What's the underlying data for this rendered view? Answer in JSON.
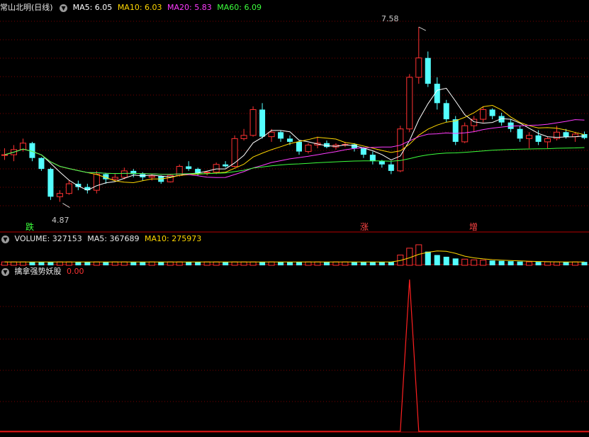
{
  "price_panel": {
    "title": "常山北明(日线)",
    "ma_legend": [
      {
        "label": "MA5: 6.05",
        "color": "#ffffff"
      },
      {
        "label": "MA10: 6.03",
        "color": "#ffd700"
      },
      {
        "label": "MA20: 5.83",
        "color": "#ff3cff"
      },
      {
        "label": "MA60: 6.09",
        "color": "#3cff3c"
      }
    ],
    "high_label": "7.58",
    "low_label": "4.87",
    "signals": [
      {
        "text": "跌",
        "color": "#3cff3c"
      },
      {
        "text": "涨",
        "color": "#ff4444"
      },
      {
        "text": "增",
        "color": "#ff4444"
      }
    ]
  },
  "volume_panel": {
    "title": "VOLUME: 327153",
    "ma5": "MA5: 367689",
    "ma10": "MA10: 275973"
  },
  "indicator_panel": {
    "title": "擒拿强势妖股",
    "value": "0.00"
  },
  "colors": {
    "up": "#ff3232",
    "down": "#54ffff",
    "grid": "#7a0000",
    "divider": "#b40000"
  },
  "chart_data": {
    "type": "candlestick",
    "approx_ohlc": [
      [
        5.6,
        5.7,
        5.52,
        5.6
      ],
      [
        5.6,
        5.75,
        5.5,
        5.68
      ],
      [
        5.68,
        5.85,
        5.65,
        5.78
      ],
      [
        5.78,
        5.8,
        5.5,
        5.55
      ],
      [
        5.55,
        5.56,
        5.35,
        5.38
      ],
      [
        5.38,
        5.4,
        4.9,
        4.95
      ],
      [
        4.95,
        5.05,
        4.87,
        5.0
      ],
      [
        5.0,
        5.2,
        4.98,
        5.15
      ],
      [
        5.15,
        5.2,
        5.05,
        5.1
      ],
      [
        5.1,
        5.15,
        5.0,
        5.05
      ],
      [
        5.05,
        5.35,
        5.0,
        5.3
      ],
      [
        5.3,
        5.32,
        5.15,
        5.22
      ],
      [
        5.22,
        5.3,
        5.18,
        5.25
      ],
      [
        5.25,
        5.4,
        5.22,
        5.35
      ],
      [
        5.35,
        5.38,
        5.25,
        5.3
      ],
      [
        5.3,
        5.33,
        5.2,
        5.25
      ],
      [
        5.25,
        5.3,
        5.2,
        5.27
      ],
      [
        5.27,
        5.28,
        5.15,
        5.18
      ],
      [
        5.18,
        5.3,
        5.17,
        5.28
      ],
      [
        5.28,
        5.45,
        5.26,
        5.42
      ],
      [
        5.42,
        5.5,
        5.35,
        5.38
      ],
      [
        5.38,
        5.4,
        5.28,
        5.32
      ],
      [
        5.32,
        5.35,
        5.28,
        5.33
      ],
      [
        5.33,
        5.48,
        5.3,
        5.45
      ],
      [
        5.45,
        5.5,
        5.4,
        5.42
      ],
      [
        5.42,
        5.9,
        5.4,
        5.85
      ],
      [
        5.85,
        6.0,
        5.82,
        5.9
      ],
      [
        5.9,
        6.35,
        5.88,
        6.3
      ],
      [
        6.3,
        6.4,
        5.85,
        5.88
      ],
      [
        5.88,
        6.0,
        5.8,
        5.95
      ],
      [
        5.95,
        5.98,
        5.8,
        5.85
      ],
      [
        5.85,
        5.9,
        5.75,
        5.8
      ],
      [
        5.8,
        5.82,
        5.6,
        5.65
      ],
      [
        5.65,
        5.78,
        5.62,
        5.75
      ],
      [
        5.75,
        5.88,
        5.7,
        5.78
      ],
      [
        5.78,
        5.82,
        5.7,
        5.72
      ],
      [
        5.72,
        5.78,
        5.68,
        5.75
      ],
      [
        5.75,
        5.8,
        5.72,
        5.76
      ],
      [
        5.76,
        5.78,
        5.65,
        5.7
      ],
      [
        5.7,
        5.72,
        5.55,
        5.6
      ],
      [
        5.6,
        5.65,
        5.45,
        5.5
      ],
      [
        5.5,
        5.52,
        5.4,
        5.45
      ],
      [
        5.45,
        5.5,
        5.3,
        5.35
      ],
      [
        5.35,
        6.05,
        5.33,
        6.0
      ],
      [
        6.0,
        6.85,
        5.95,
        6.8
      ],
      [
        6.8,
        7.58,
        6.7,
        7.1
      ],
      [
        7.1,
        7.2,
        6.65,
        6.7
      ],
      [
        6.7,
        6.8,
        6.3,
        6.4
      ],
      [
        6.4,
        6.45,
        6.1,
        6.15
      ],
      [
        6.15,
        6.2,
        5.75,
        5.8
      ],
      [
        5.8,
        6.1,
        5.78,
        6.05
      ],
      [
        6.05,
        6.2,
        5.95,
        6.15
      ],
      [
        6.15,
        6.35,
        6.1,
        6.3
      ],
      [
        6.3,
        6.32,
        6.15,
        6.2
      ],
      [
        6.2,
        6.25,
        6.05,
        6.1
      ],
      [
        6.1,
        6.15,
        5.95,
        6.0
      ],
      [
        6.0,
        6.05,
        5.8,
        5.85
      ],
      [
        5.85,
        5.95,
        5.7,
        5.9
      ],
      [
        5.9,
        5.98,
        5.75,
        5.8
      ],
      [
        5.8,
        5.88,
        5.7,
        5.85
      ],
      [
        5.85,
        6.05,
        5.82,
        5.95
      ],
      [
        5.95,
        6.0,
        5.85,
        5.88
      ],
      [
        5.88,
        5.95,
        5.8,
        5.92
      ],
      [
        5.92,
        5.96,
        5.84,
        5.86
      ]
    ],
    "approx_volume_relative": [
      1,
      1,
      1,
      1,
      1,
      1,
      1,
      1,
      1,
      1,
      1,
      1,
      1,
      1,
      1,
      1,
      1,
      1,
      1,
      1,
      1,
      1,
      1,
      1,
      1,
      1,
      1,
      1,
      1,
      1,
      1,
      1,
      1,
      1,
      1,
      1,
      1,
      1,
      1,
      1,
      1,
      1,
      1,
      3,
      5,
      6,
      4,
      3,
      2.5,
      2,
      1.8,
      1.6,
      1.5,
      1.4,
      1.3,
      1.2,
      1.1,
      1,
      1,
      1,
      1,
      1,
      1,
      1
    ],
    "indicator_spike_index": 44
  }
}
